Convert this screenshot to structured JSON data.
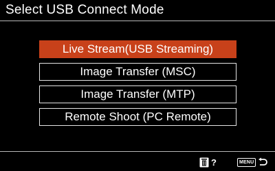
{
  "header": {
    "title": "Select USB Connect Mode"
  },
  "menu": {
    "items": [
      {
        "label": "Live Stream(USB Streaming)",
        "selected": true
      },
      {
        "label": "Image Transfer (MSC)",
        "selected": false
      },
      {
        "label": "Image Transfer (MTP)",
        "selected": false
      },
      {
        "label": "Remote Shoot (PC Remote)",
        "selected": false
      }
    ]
  },
  "footer": {
    "help_icon": "trash-help-icon",
    "help_mark": "?",
    "menu_badge": "MENU",
    "back_icon": "return-arrow-icon"
  },
  "colors": {
    "background": "#000000",
    "selected": "#c8411a",
    "border": "#e6e6e6",
    "text": "#ffffff"
  }
}
